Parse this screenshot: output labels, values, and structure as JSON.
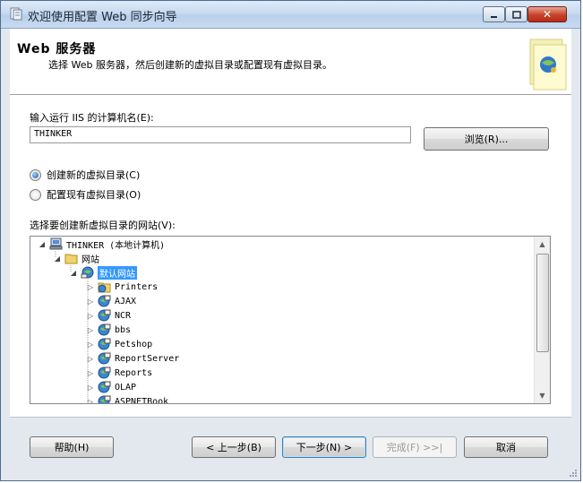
{
  "window": {
    "title": "欢迎使用配置 Web 同步向导",
    "close_glyph": "✕"
  },
  "header": {
    "title": "Web 服务器",
    "subtitle": "选择 Web 服务器，然后创建新的虚拟目录或配置现有虚拟目录。"
  },
  "form": {
    "computer_label": "输入运行 IIS 的计算机名(E):",
    "computer_value": "THINKER",
    "browse_label": "浏览(R)...",
    "radio_create": "创建新的虚拟目录(C)",
    "radio_configure": "配置现有虚拟目录(O)",
    "selected_option": "create",
    "site_label": "选择要创建新虚拟目录的网站(V):"
  },
  "tree": {
    "computer": "THINKER (本地计算机)",
    "websites": "网站",
    "default_site": "默认网站",
    "children": [
      "Printers",
      "AJAX",
      "NCR",
      "bbs",
      "Petshop",
      "ReportServer",
      "Reports",
      "OLAP",
      "ASPNETBook"
    ]
  },
  "footer": {
    "help": "帮助(H)",
    "back": "< 上一步(B)",
    "next": "下一步(N) >",
    "finish": "完成(F) >>|",
    "cancel": "取消"
  }
}
